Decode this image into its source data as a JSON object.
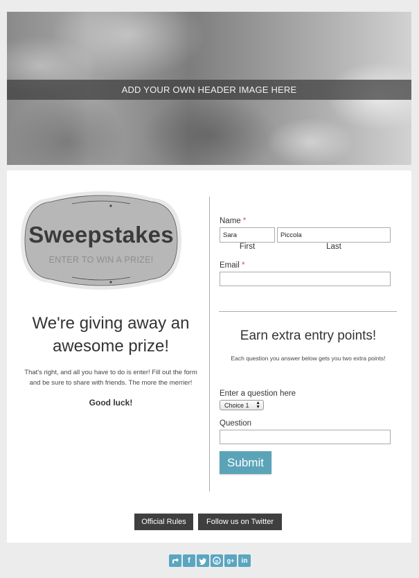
{
  "header": {
    "banner_text": "ADD YOUR OWN HEADER IMAGE HERE"
  },
  "badge": {
    "title": "Sweepstakes",
    "subtitle": "ENTER TO WIN A PRIZE!"
  },
  "promo": {
    "headline": "We're giving away an awesome prize!",
    "body": "That's right, and all you have to do is enter! Fill out the form and be sure to share with friends. The more the merrier!",
    "closing": "Good luck!"
  },
  "form": {
    "name_label": "Name",
    "required_mark": "*",
    "first_name_value": "Sara",
    "last_name_value": "Piccola",
    "first_sublabel": "First",
    "last_sublabel": "Last",
    "email_label": "Email",
    "email_value": "",
    "extra_title": "Earn extra entry points!",
    "extra_subtitle": "Each question you answer below gets you two extra points!",
    "question1_label": "Enter a question here",
    "question1_selected": "Choice 1",
    "question2_label": "Question",
    "question2_value": "",
    "submit_label": "Submit"
  },
  "footer": {
    "rules_label": "Official Rules",
    "twitter_label": "Follow us on Twitter"
  },
  "share": {
    "icons": [
      "share-icon",
      "facebook-icon",
      "twitter-icon",
      "pinterest-icon",
      "google-plus-icon",
      "linkedin-icon"
    ]
  },
  "colors": {
    "accent": "#5ba4b8",
    "dark_button": "#3f3f3f",
    "required": "#d9534f",
    "background": "#ececec"
  }
}
